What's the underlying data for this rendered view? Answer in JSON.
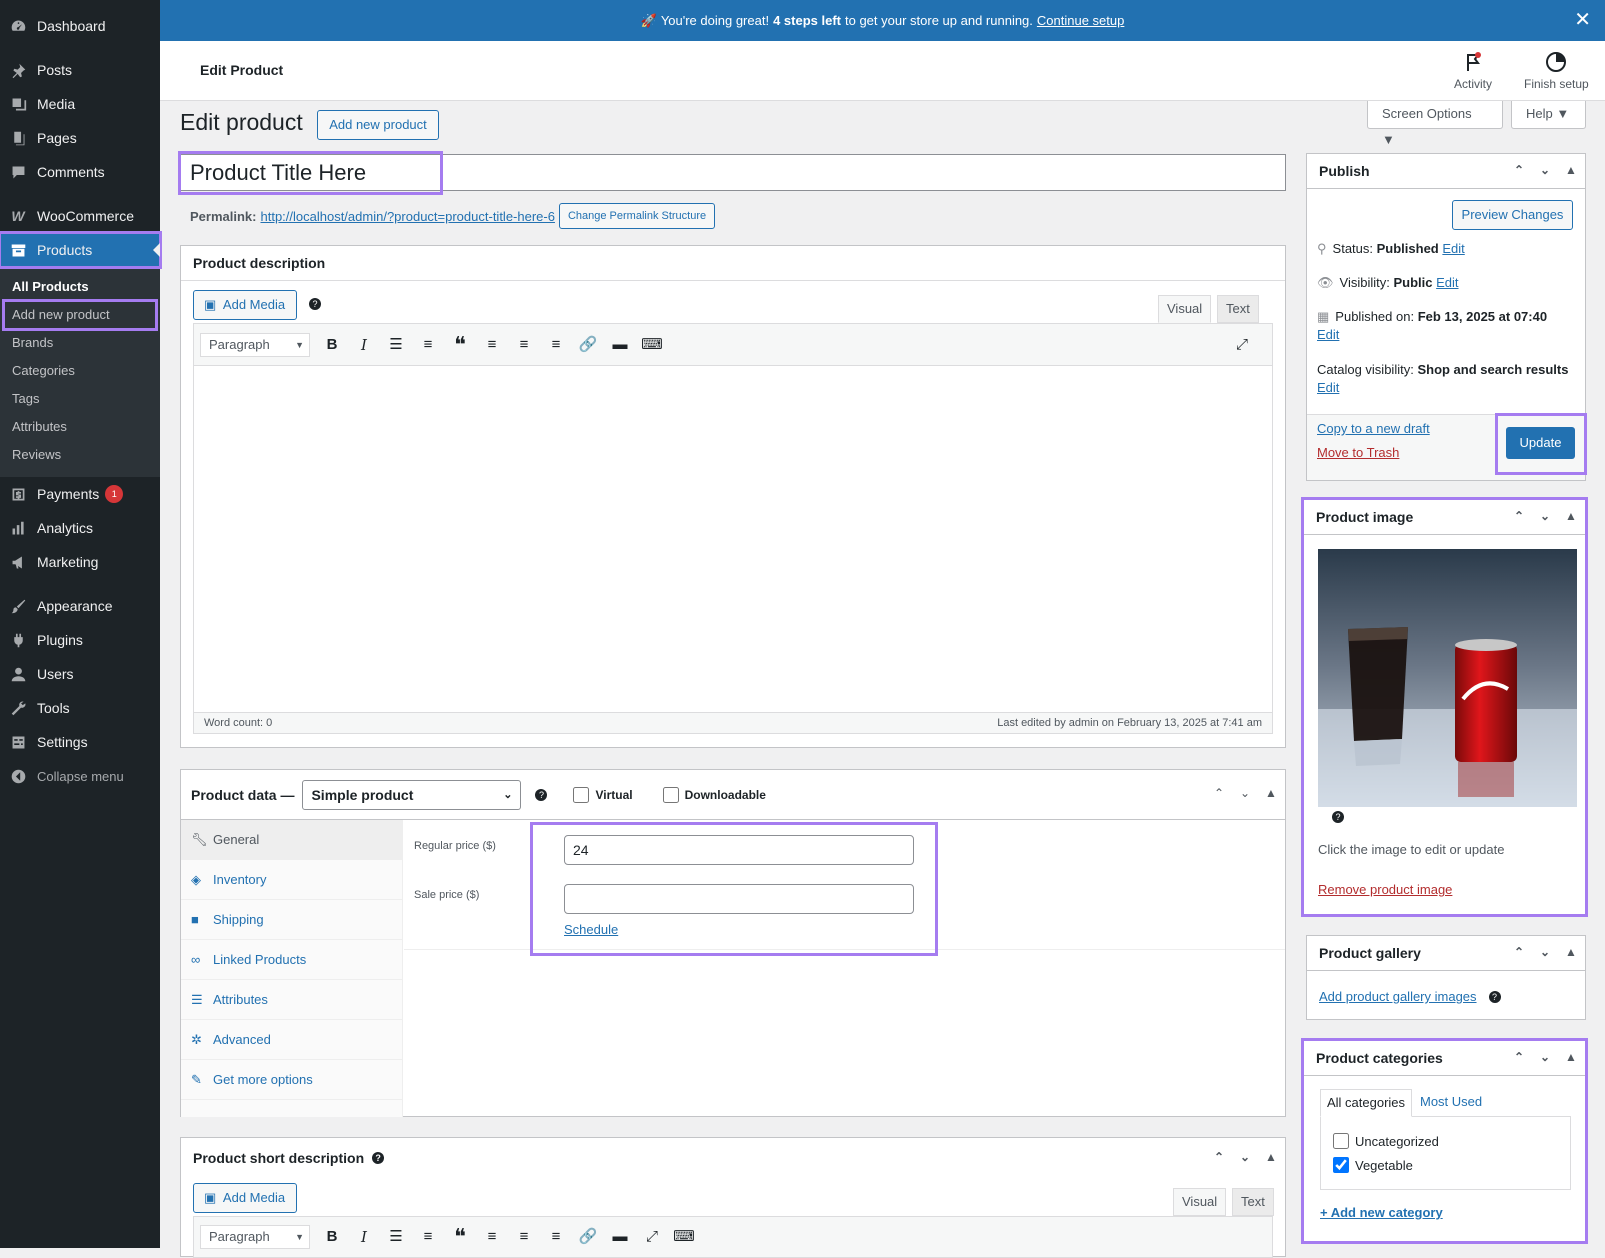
{
  "notice": {
    "emoji": "🚀",
    "text_pre": "You're doing great!",
    "text_bold": "4 steps left",
    "text_post": "to get your store up and running.",
    "link": "Continue setup",
    "close": "✕"
  },
  "topbar": {
    "title": "Edit Product",
    "activity": "Activity",
    "finish": "Finish setup"
  },
  "screen_options": "Screen Options ▼",
  "help": "Help ▼",
  "sidebar": {
    "items": [
      {
        "label": "Dashboard"
      },
      {
        "label": "Posts"
      },
      {
        "label": "Media"
      },
      {
        "label": "Pages"
      },
      {
        "label": "Comments"
      },
      {
        "label": "WooCommerce"
      },
      {
        "label": "Products"
      },
      {
        "label": "Payments",
        "badge": "1"
      },
      {
        "label": "Analytics"
      },
      {
        "label": "Marketing"
      },
      {
        "label": "Appearance"
      },
      {
        "label": "Plugins"
      },
      {
        "label": "Users"
      },
      {
        "label": "Tools"
      },
      {
        "label": "Settings"
      },
      {
        "label": "Collapse menu"
      }
    ],
    "products_sub": [
      "All Products",
      "Add new product",
      "Brands",
      "Categories",
      "Tags",
      "Attributes",
      "Reviews"
    ]
  },
  "page": {
    "heading": "Edit product",
    "add_new": "Add new product",
    "product_title": "Product Title Here",
    "permalink_label": "Permalink:",
    "permalink_url": "http://localhost/admin/?product=product-title-here-6",
    "change_permalink": "Change Permalink Structure"
  },
  "description": {
    "title": "Product description",
    "add_media": "Add Media",
    "help": "?",
    "tab_visual": "Visual",
    "tab_text": "Text",
    "format": "Paragraph",
    "word_count": "Word count: 0",
    "last_edited": "Last edited by admin on February 13, 2025 at 7:41 am"
  },
  "product_data": {
    "title": "Product data —",
    "type": "Simple product",
    "virtual": "Virtual",
    "downloadable": "Downloadable",
    "tabs": [
      "General",
      "Inventory",
      "Shipping",
      "Linked Products",
      "Attributes",
      "Advanced",
      "Get more options"
    ],
    "regular_label": "Regular price ($)",
    "regular_value": "24",
    "sale_label": "Sale price ($)",
    "sale_value": "",
    "schedule": "Schedule"
  },
  "short_desc": {
    "title": "Product short description",
    "add_media": "Add Media",
    "tab_visual": "Visual",
    "tab_text": "Text",
    "format": "Paragraph"
  },
  "publish": {
    "title": "Publish",
    "preview": "Preview Changes",
    "status_label": "Status:",
    "status": "Published",
    "visibility_label": "Visibility:",
    "visibility": "Public",
    "published_label": "Published on:",
    "published": "Feb 13, 2025 at 07:40",
    "catalog_label": "Catalog visibility:",
    "catalog": "Shop and search results",
    "edit": "Edit",
    "copy": "Copy to a new draft",
    "trash": "Move to Trash",
    "update": "Update"
  },
  "image_box": {
    "title": "Product image",
    "hint": "Click the image to edit or update",
    "remove": "Remove product image",
    "help": "?"
  },
  "gallery": {
    "title": "Product gallery",
    "add": "Add product gallery images",
    "help": "?"
  },
  "categories": {
    "title": "Product categories",
    "tab_all": "All categories",
    "tab_most": "Most Used",
    "items": [
      {
        "label": "Uncategorized",
        "checked": false
      },
      {
        "label": "Vegetable",
        "checked": true
      }
    ],
    "add": "+ Add new category"
  }
}
